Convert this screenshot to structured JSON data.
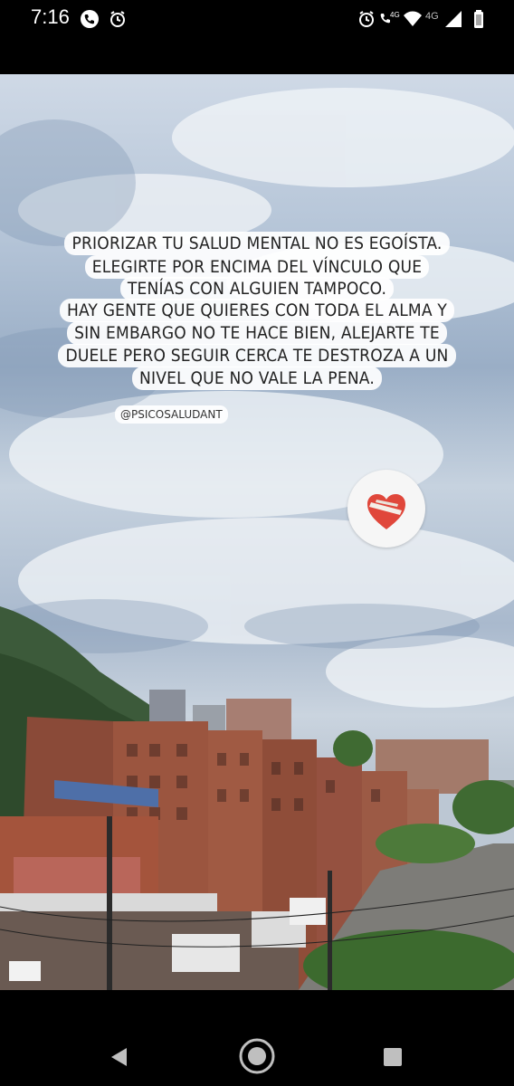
{
  "status_bar": {
    "time": "7:16",
    "network_left": "4G",
    "network_right": "4G"
  },
  "story": {
    "quote_lines": [
      "PRIORIZAR TU SALUD MENTAL NO ES EGOÍSTA.",
      "ELEGIRTE POR ENCIMA DEL VÍNCULO QUE",
      "TENÍAS CON ALGUIEN TAMPOCO.",
      "HAY GENTE QUE QUIERES CON TODA EL ALMA Y",
      "SIN EMBARGO NO TE HACE BIEN, ALEJARTE TE",
      "DUELE PERO SEGUIR CERCA TE DESTROZA A UN",
      "NIVEL QUE NO VALE LA PENA."
    ],
    "handle": "@PSICOSALUDANT",
    "sticker_icon": "mending-heart-icon"
  },
  "navigation": {
    "back_icon": "back-triangle-icon",
    "home_icon": "home-circle-icon",
    "recents_icon": "recents-square-icon"
  }
}
